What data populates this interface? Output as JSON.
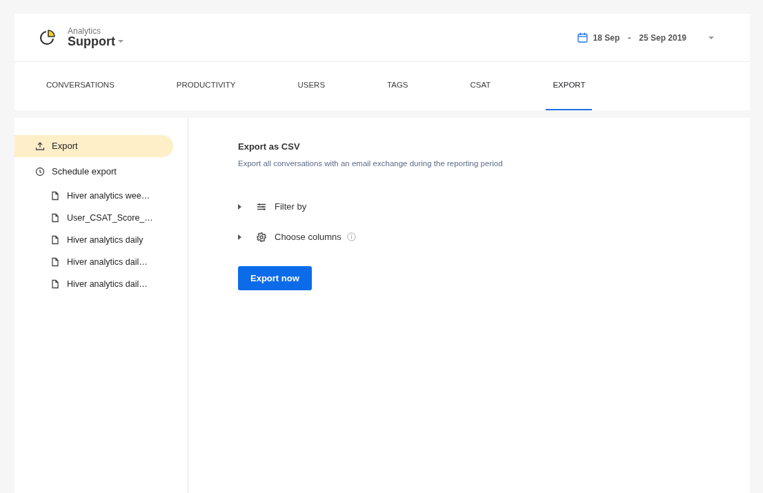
{
  "header": {
    "subtitle": "Analytics",
    "title": "Support",
    "date_range": {
      "start": "18 Sep",
      "separator": "-",
      "end": "25 Sep 2019"
    }
  },
  "tabs": [
    {
      "label": "CONVERSATIONS",
      "selected": false
    },
    {
      "label": "PRODUCTIVITY",
      "selected": false
    },
    {
      "label": "USERS",
      "selected": false
    },
    {
      "label": "TAGS",
      "selected": false
    },
    {
      "label": "CSAT",
      "selected": false
    },
    {
      "label": "EXPORT",
      "selected": true
    }
  ],
  "sidebar": {
    "items": [
      {
        "kind": "upload",
        "label": "Export",
        "selected": true
      },
      {
        "kind": "clock",
        "label": "Schedule export",
        "selected": false,
        "children": [
          {
            "kind": "file",
            "label": "Hiver analytics wee…",
            "selected": false
          },
          {
            "kind": "file",
            "label": "User_CSAT_Score_…",
            "selected": false
          },
          {
            "kind": "file",
            "label": "Hiver analytics daily",
            "selected": false
          },
          {
            "kind": "file",
            "label": "Hiver analytics dail…",
            "selected": false
          },
          {
            "kind": "file",
            "label": "Hiver analytics dail…",
            "selected": false
          }
        ]
      }
    ]
  },
  "panel": {
    "title": "Export as CSV",
    "description": "Export all conversations with an email exchange during the reporting period",
    "sections": [
      {
        "kind": "filter",
        "label": "Filter by",
        "expanded": false,
        "info": false
      },
      {
        "kind": "columns",
        "label": "Choose columns",
        "expanded": false,
        "info": true
      }
    ],
    "button": "Export now"
  }
}
